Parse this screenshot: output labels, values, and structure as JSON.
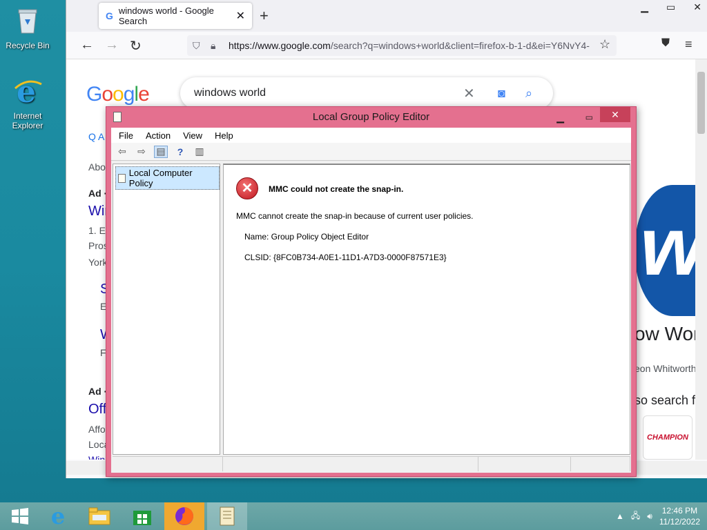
{
  "desktop": {
    "icons": [
      {
        "label": "Recycle Bin"
      },
      {
        "label": "Internet Explorer"
      }
    ]
  },
  "browser": {
    "tab_title": "windows world - Google Search",
    "url_domain": "https://www.google.com",
    "url_rest": "/search?q=windows+world&client=firefox-b-1-d&ei=Y6NvY4-",
    "search_query": "windows world",
    "bg": {
      "about": "Abou",
      "ad1": "Ad ·",
      "link1": "Win",
      "line1": "1. E",
      "line2": "Pros",
      "line3": "York",
      "s1": "S",
      "e1": "E",
      "w1": "W",
      "f1": "F",
      "ad2": "Ad ·",
      "link2": "Off",
      "line4": "Affo",
      "line5": "Loca",
      "line6": "Wind",
      "right1": "ow Wor",
      "right2": "eon Whitworth",
      "right3": "so search fo",
      "champion": "CHAMPION"
    }
  },
  "mmc": {
    "title": "Local Group Policy Editor",
    "menu": [
      "File",
      "Action",
      "View",
      "Help"
    ],
    "tree_root": "Local Computer Policy",
    "error_heading": "MMC could not create the snap-in.",
    "error_message": "MMC cannot create the snap-in because of current user policies.",
    "name_line": "Name: Group Policy Object Editor",
    "clsid_line": "CLSID: {8FC0B734-A0E1-11D1-A7D3-0000F87571E3}"
  },
  "taskbar": {
    "time": "12:46 PM",
    "date": "11/12/2022"
  }
}
